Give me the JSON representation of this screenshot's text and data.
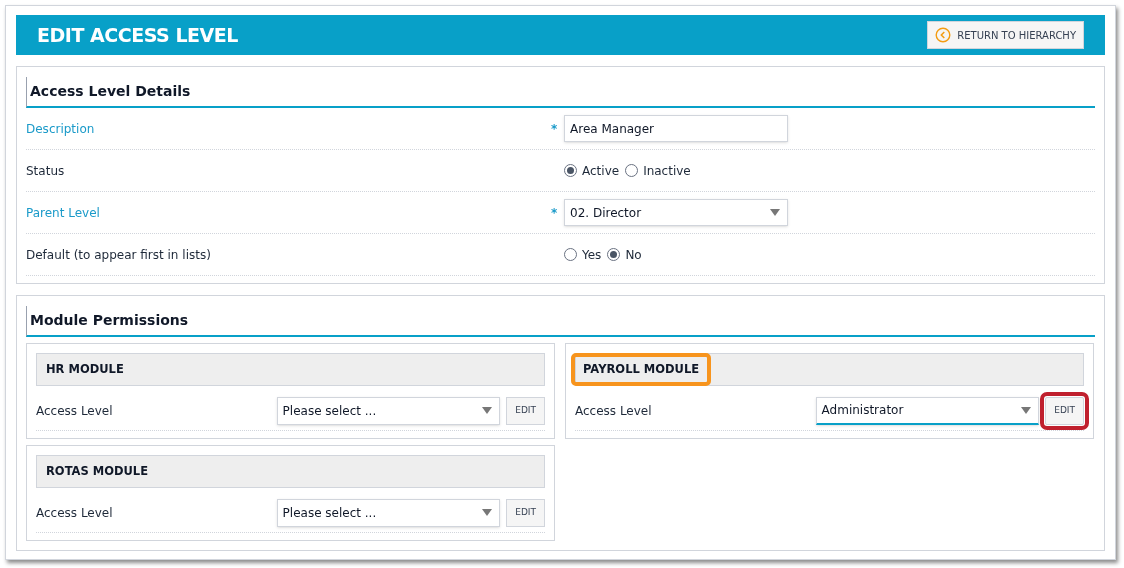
{
  "header": {
    "title": "EDIT ACCESS LEVEL",
    "return_button": "RETURN TO HIERARCHY"
  },
  "details": {
    "heading": "Access Level Details",
    "rows": [
      {
        "kind": "text",
        "label": "Description",
        "required": true,
        "asterisk": "*",
        "value": "Area Manager"
      },
      {
        "kind": "radio",
        "label": "Status",
        "required": false,
        "options": [
          {
            "label": "Active",
            "selected": true
          },
          {
            "label": "Inactive",
            "selected": false
          }
        ]
      },
      {
        "kind": "select",
        "label": "Parent Level",
        "required": true,
        "asterisk": "*",
        "value": "02. Director"
      },
      {
        "kind": "radio",
        "label": "Default (to appear first in lists)",
        "required": false,
        "options": [
          {
            "label": "Yes",
            "selected": false
          },
          {
            "label": "No",
            "selected": true
          }
        ]
      }
    ]
  },
  "permissions": {
    "heading": "Module Permissions",
    "columns": [
      {
        "modules": [
          {
            "title": "HR MODULE",
            "label": "Access Level",
            "value": "Please select ...",
            "edit": "EDIT",
            "focused": false,
            "title_highlighted": false,
            "edit_highlighted": false
          },
          {
            "title": "ROTAS MODULE",
            "label": "Access Level",
            "value": "Please select ...",
            "edit": "EDIT",
            "focused": false,
            "title_highlighted": false,
            "edit_highlighted": false
          }
        ]
      },
      {
        "modules": [
          {
            "title": "PAYROLL MODULE",
            "label": "Access Level",
            "value": "Administrator",
            "edit": "EDIT",
            "focused": true,
            "title_highlighted": true,
            "edit_highlighted": true
          }
        ]
      }
    ]
  }
}
